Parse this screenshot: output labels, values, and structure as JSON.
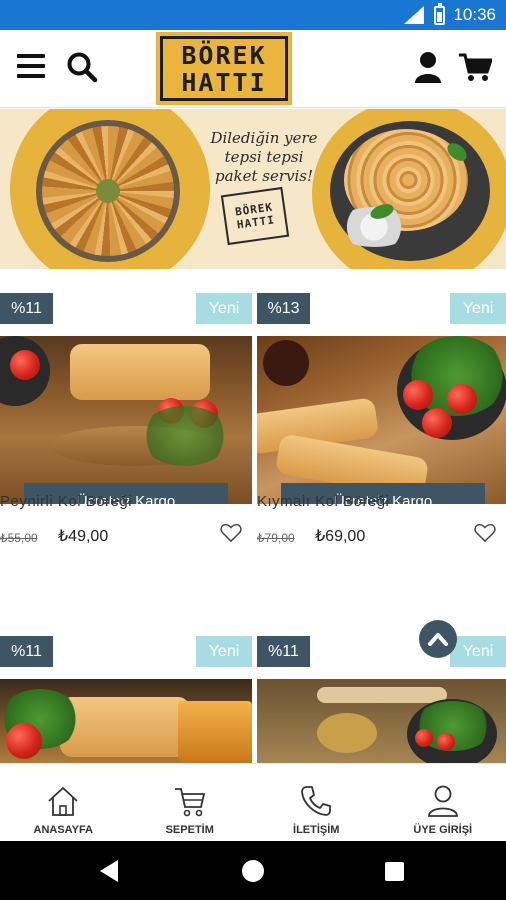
{
  "status_bar": {
    "network": "LTE",
    "time": "10:36"
  },
  "header": {
    "logo_line1": "BÖREK",
    "logo_line2": "HATTI"
  },
  "banner": {
    "text_line1": "Dilediğin yere",
    "text_line2": "tepsi tepsi",
    "text_line3": "paket servis!",
    "mini_logo_line1": "BÖREK",
    "mini_logo_line2": "HATTI"
  },
  "products": [
    {
      "discount": "%11",
      "new_label": "Yeni",
      "cargo_label": "Ücretsiz Kargo",
      "name": "Peynirli Kol Böreği",
      "old_price": "₺55,00",
      "price": "₺49,00"
    },
    {
      "discount": "%13",
      "new_label": "Yeni",
      "cargo_label": "Ücretsiz Kargo",
      "name": "Kıymalı Kol Böreği",
      "old_price": "₺79,00",
      "price": "₺69,00"
    },
    {
      "discount": "%11",
      "new_label": "Yeni"
    },
    {
      "discount": "%11",
      "new_label": "Yeni"
    }
  ],
  "bottom_nav": [
    {
      "label": "ANASAYFA",
      "icon": "home-icon"
    },
    {
      "label": "SEPETİM",
      "icon": "cart-icon"
    },
    {
      "label": "İLETİŞİM",
      "icon": "phone-icon"
    },
    {
      "label": "ÜYE GİRİŞİ",
      "icon": "user-icon"
    }
  ],
  "colors": {
    "status_bar": "#1976d2",
    "badge_dark": "#3e5566",
    "badge_new": "#a7dde2",
    "logo_bg": "#e9b53f"
  }
}
